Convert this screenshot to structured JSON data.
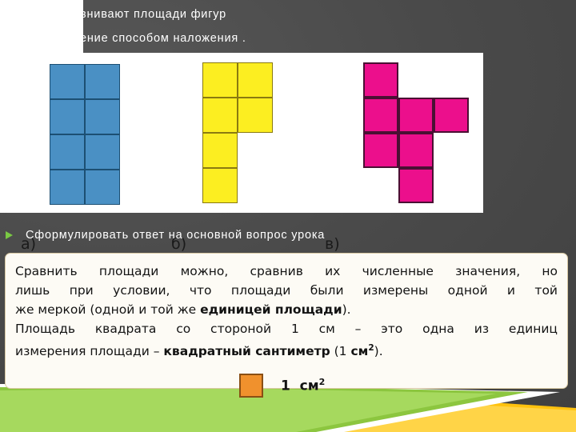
{
  "slide": {
    "background_color": "#4a4a4a",
    "bullet_color": "#7ac943"
  },
  "bullets": [
    {
      "text": "внивают площади фигур",
      "occluded": true
    },
    {
      "text": "ение способом наложения .",
      "occluded": true
    },
    {
      "text": "Сформулировать ответ на  основной вопрос  урока",
      "occluded": false
    }
  ],
  "figures": {
    "panel_background": "#ffffff",
    "items": [
      {
        "label": "а)",
        "color": "#4a90c4",
        "border_color": "#1c4f73",
        "square_count": 8,
        "grid": [
          [
            1,
            1
          ],
          [
            1,
            1
          ],
          [
            1,
            1
          ],
          [
            1,
            1
          ]
        ],
        "description": "2 columns by 4 rows rectangle"
      },
      {
        "label": "б)",
        "color": "#fcee21",
        "border_color": "#8a7a10",
        "square_count": 6,
        "grid": [
          [
            1,
            1
          ],
          [
            1,
            1
          ],
          [
            1,
            0
          ],
          [
            1,
            0
          ]
        ],
        "description": "2x2 block on top with 2 squares below on the left column"
      },
      {
        "label": "в)",
        "color": "#ec0f8c",
        "border_color": "#4a1033",
        "square_count": 7,
        "grid": [
          [
            1,
            0,
            0
          ],
          [
            1,
            1,
            1
          ],
          [
            1,
            1,
            0
          ],
          [
            0,
            1,
            0
          ]
        ],
        "description": "cross-like figure"
      }
    ]
  },
  "definition_box": {
    "border_color": "#d9c9a3",
    "background_color": "#fdfbf5",
    "lines": [
      "Сравнить  площади  можно,  сравнив  их  численные  значения,  но",
      "лишь  при  условии,  что  площади  были  измерены  одной  и  той",
      "же  меркой  (одной  и  той  же  единицей  площади).",
      "Площадь  квадрата  со  стороной  1  см  –  это  одна  из  единиц",
      "измерения  площади  –  квадратный  сантиметр  (1  см2)."
    ],
    "bold_phrases": [
      "единицей площади",
      "квадратный сантиметр",
      "см"
    ],
    "unit": {
      "swatch_color": "#f0912d",
      "swatch_border": "#8a4f14",
      "label": "1  см",
      "exponent": "2"
    }
  },
  "decoration": {
    "green": "#8cc63f",
    "green_light": "#a6d95e",
    "yellow": "#ffc20e",
    "yellow_light": "#ffd447",
    "white": "#ffffff"
  }
}
